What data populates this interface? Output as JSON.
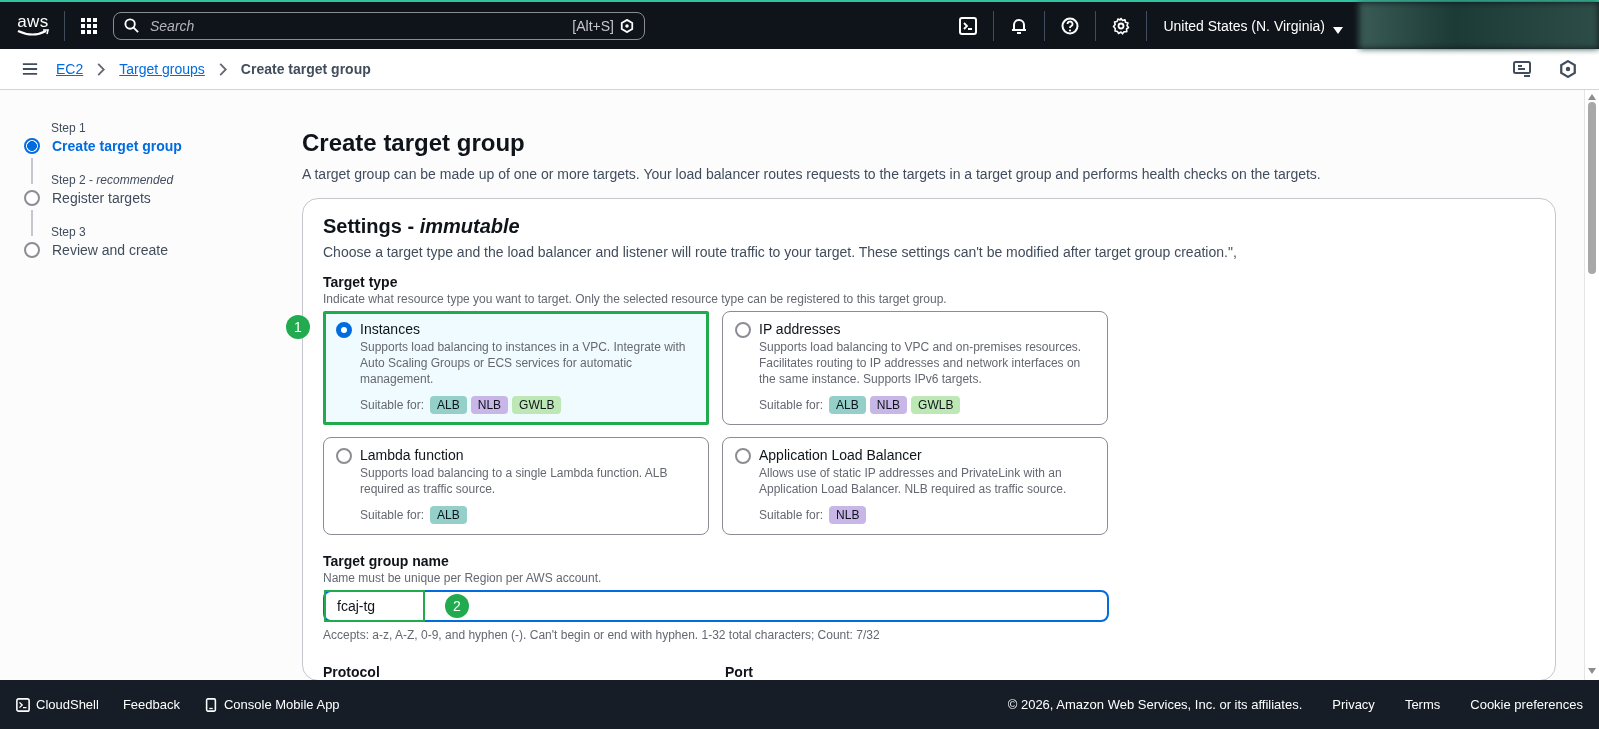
{
  "top_bar": {
    "logo": "aws",
    "search": {
      "placeholder": "Search",
      "shortcut": "[Alt+S]"
    },
    "region": "United States (N. Virginia)"
  },
  "breadcrumbs": [
    {
      "label": "EC2",
      "link": true
    },
    {
      "label": "Target groups",
      "link": true
    },
    {
      "label": "Create target group",
      "link": false
    }
  ],
  "steps": [
    {
      "step": "Step 1",
      "title": "Create target group",
      "selected": true
    },
    {
      "step": "Step 2 - *recommended*",
      "title": "Register targets",
      "selected": false
    },
    {
      "step": "Step 3",
      "title": "Review and create",
      "selected": false
    }
  ],
  "page": {
    "title": "Create target group",
    "description": "A target group can be made up of one or more targets. Your load balancer routes requests to the targets in a target group and performs health checks on the targets."
  },
  "settings": {
    "title": "Settings - *immutable*",
    "description": "Choose a target type and the load balancer and listener will route traffic to your target. These settings can't be modified after target group creation.\",",
    "target_type": {
      "label": "Target type",
      "hint": "Indicate what resource type you want to target. Only the selected resource type can be registered to this target group.",
      "options": [
        {
          "title": "Instances",
          "description": "Supports load balancing to instances in a VPC. Integrate with Auto Scaling Groups or ECS services for automatic management.",
          "suitable_label": "Suitable for:",
          "selected": true,
          "highlighted": true,
          "callout": "1",
          "tags": [
            {
              "label": "ALB",
              "color": "#94cfc9"
            },
            {
              "label": "NLB",
              "color": "#c8b6e8"
            },
            {
              "label": "GWLB",
              "color": "#bde8b5"
            }
          ]
        },
        {
          "title": "IP addresses",
          "description": "Supports load balancing to VPC and on-premises resources. Facilitates routing to IP addresses and network interfaces on the same instance. Supports IPv6 targets.",
          "suitable_label": "Suitable for:",
          "selected": false,
          "highlighted": false,
          "tags": [
            {
              "label": "ALB",
              "color": "#94cfc9"
            },
            {
              "label": "NLB",
              "color": "#c8b6e8"
            },
            {
              "label": "GWLB",
              "color": "#bde8b5"
            }
          ]
        },
        {
          "title": "Lambda function",
          "description": "Supports load balancing to a single Lambda function. ALB required as traffic source.",
          "suitable_label": "Suitable for:",
          "selected": false,
          "highlighted": false,
          "tags": [
            {
              "label": "ALB",
              "color": "#94cfc9"
            }
          ]
        },
        {
          "title": "Application Load Balancer",
          "description": "Allows use of static IP addresses and PrivateLink with an Application Load Balancer. NLB required as traffic source.",
          "suitable_label": "Suitable for:",
          "selected": false,
          "highlighted": false,
          "tags": [
            {
              "label": "NLB",
              "color": "#c8b6e8"
            }
          ]
        }
      ]
    },
    "name_field": {
      "label": "Target group name",
      "hint": "Name must be unique per Region per AWS account.",
      "value": "fcaj-tg",
      "highlighted": true,
      "callout": "2",
      "constraint": "Accepts: a-z, A-Z, 0-9, and hyphen (-). Can't begin or end with hyphen. 1-32 total characters; Count: 7/32"
    },
    "protocol_label": "Protocol",
    "port_label": "Port"
  },
  "footer": {
    "left": [
      {
        "label": "CloudShell",
        "kind": "terminal"
      },
      {
        "label": "Feedback",
        "kind": "plain"
      },
      {
        "label": "Console Mobile App",
        "kind": "phone"
      }
    ],
    "copyright": "© 2026, Amazon Web Services, Inc. or its affiliates.",
    "links": [
      "Privacy",
      "Terms",
      "Cookie preferences"
    ]
  }
}
